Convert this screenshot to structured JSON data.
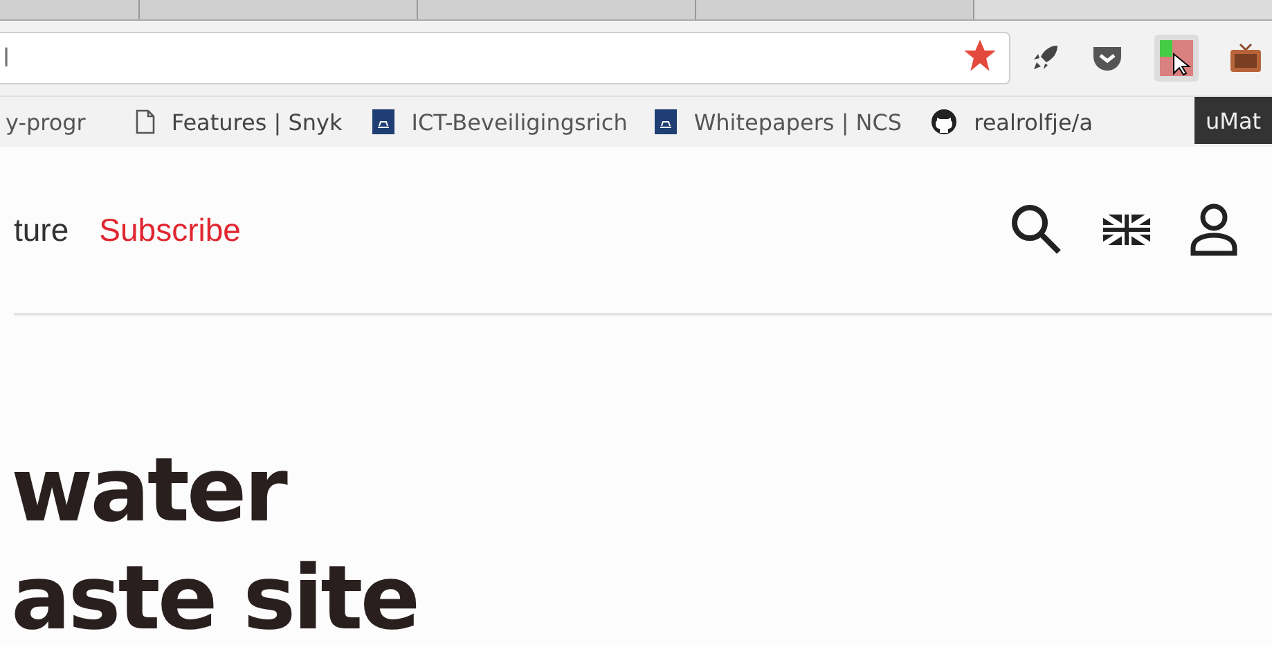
{
  "address_bar": {
    "url": "l",
    "bookmarked": true
  },
  "bookmarks": [
    {
      "kind": "plain",
      "label": "y-progr"
    },
    {
      "kind": "page",
      "label": "Features | Snyk"
    },
    {
      "kind": "shield",
      "label": "ICT-Beveiligingsrich"
    },
    {
      "kind": "shield",
      "label": "Whitepapers | NCS"
    },
    {
      "kind": "github",
      "label": "realrolfje/a"
    }
  ],
  "tooltip": "uMat",
  "nav": [
    {
      "label": "ture",
      "highlighted": false
    },
    {
      "label": "Subscribe",
      "highlighted": true
    }
  ],
  "headline": [
    "water",
    "aste site"
  ]
}
